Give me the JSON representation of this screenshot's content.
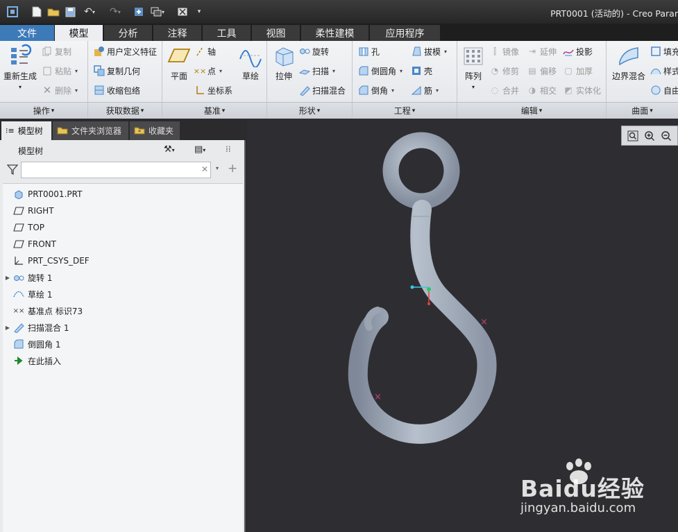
{
  "window": {
    "title": "PRT0001 (活动的) - Creo Parar"
  },
  "menu_tabs": [
    "文件",
    "模型",
    "分析",
    "注释",
    "工具",
    "视图",
    "柔性建模",
    "应用程序"
  ],
  "ribbon": {
    "operations": {
      "title": "操作",
      "regen": "重新生成",
      "copy": "复制",
      "paste": "粘贴",
      "delete": "删除"
    },
    "get_data": {
      "title": "获取数据",
      "udf": "用户定义特征",
      "copy_geom": "复制几何",
      "shrinkwrap": "收缩包络"
    },
    "datum": {
      "title": "基准",
      "plane": "平面",
      "axis": "轴",
      "point": "点",
      "csys": "坐标系",
      "sketch": "草绘"
    },
    "shapes": {
      "title": "形状",
      "extrude": "拉伸",
      "revolve": "旋转",
      "sweep": "扫描",
      "swept_blend": "扫描混合"
    },
    "engineering": {
      "title": "工程",
      "hole": "孔",
      "round": "倒圆角",
      "chamfer": "倒角",
      "draft": "拔模",
      "shell": "壳",
      "rib": "筋"
    },
    "editing": {
      "title": "编辑",
      "pattern": "阵列",
      "mirror": "镜像",
      "extend": "延伸",
      "project": "投影",
      "trim": "修剪",
      "offset": "偏移",
      "thicken": "加厚",
      "merge": "合并",
      "intersect": "相交",
      "solidify": "实体化"
    },
    "surfaces": {
      "title": "曲面",
      "boundary_blend": "边界混合",
      "fill": "填充",
      "style": "样式",
      "freestyle": "自由"
    }
  },
  "panel_tabs": [
    "模型树",
    "文件夹浏览器",
    "收藏夹"
  ],
  "model_tree": {
    "title": "模型树",
    "filter_placeholder": "",
    "items": [
      {
        "label": "PRT0001.PRT",
        "icon": "part-icon",
        "expand": false
      },
      {
        "label": "RIGHT",
        "icon": "datum-plane-icon",
        "expand": false
      },
      {
        "label": "TOP",
        "icon": "datum-plane-icon",
        "expand": false
      },
      {
        "label": "FRONT",
        "icon": "datum-plane-icon",
        "expand": false
      },
      {
        "label": "PRT_CSYS_DEF",
        "icon": "csys-icon",
        "expand": false
      },
      {
        "label": "旋转 1",
        "icon": "revolve-icon",
        "expand": true
      },
      {
        "label": "草绘 1",
        "icon": "sketch-icon",
        "expand": false
      },
      {
        "label": "基准点 标识73",
        "icon": "datum-point-icon",
        "expand": false
      },
      {
        "label": "扫描混合 1",
        "icon": "swept-blend-icon",
        "expand": true
      },
      {
        "label": "倒圆角 1",
        "icon": "round-icon",
        "expand": false
      },
      {
        "label": "在此插入",
        "icon": "insert-arrow-icon",
        "expand": false
      }
    ]
  },
  "watermark": {
    "brand": "Baidu经验",
    "url": "jingyan.baidu.com"
  },
  "colors": {
    "accent": "#3d7ab8",
    "viewport_bg": "#2e2e32",
    "hook": "#a8b2c0"
  }
}
